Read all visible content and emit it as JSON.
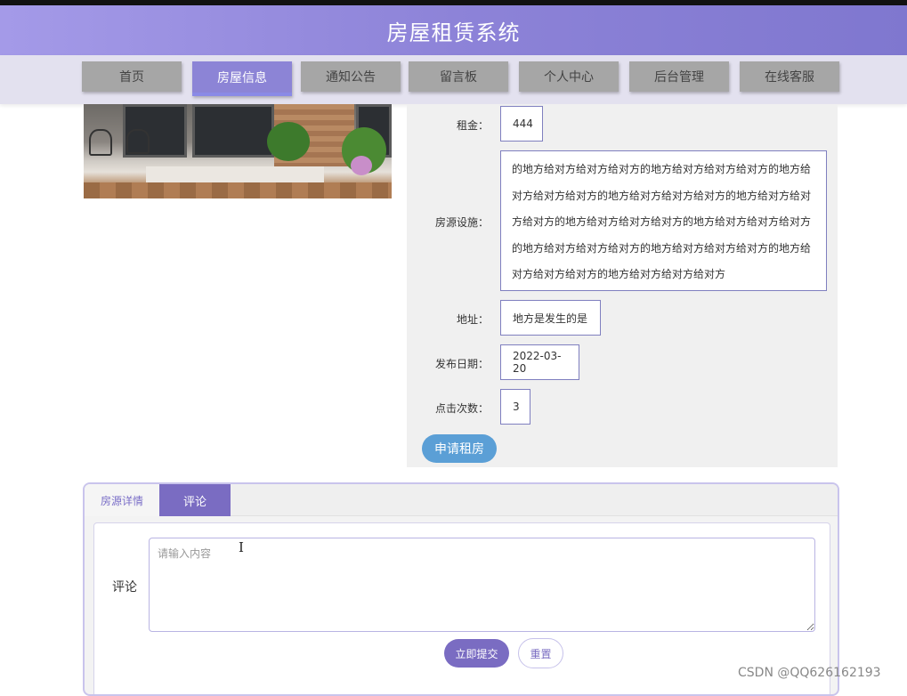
{
  "header": {
    "title": "房屋租赁系统"
  },
  "nav": {
    "items": [
      {
        "label": "首页",
        "active": false
      },
      {
        "label": "房屋信息",
        "active": true
      },
      {
        "label": "通知公告",
        "active": false
      },
      {
        "label": "留言板",
        "active": false
      },
      {
        "label": "个人中心",
        "active": false
      },
      {
        "label": "后台管理",
        "active": false
      },
      {
        "label": "在线客服",
        "active": false
      }
    ]
  },
  "detail": {
    "rent": {
      "label": "租金：",
      "value": "444"
    },
    "facilities": {
      "label": "房源设施：",
      "lines": [
        "的地方给对方给对方给对方的地方给对方给对方给对方的地方给",
        "对方给对方给对方的地方给对方给对方给对方的地方给对方给对",
        "方给对方的地方给对方给对方给对方的地方给对方给对方给对方",
        "的地方给对方给对方给对方的地方给对方给对方给对方的地方给",
        "对方给对方给对方的地方给对方给对方给对方"
      ]
    },
    "address": {
      "label": "地址：",
      "value": "地方是发生的是"
    },
    "publish_date": {
      "label": "发布日期：",
      "value": "2022-03-20"
    },
    "clicks": {
      "label": "点击次数：",
      "value": "3"
    },
    "apply_button": "申请租房"
  },
  "tabs": {
    "items": [
      {
        "label": "房源详情",
        "active": false
      },
      {
        "label": "评论",
        "active": true
      }
    ]
  },
  "comment": {
    "label": "评论",
    "placeholder": "请输入内容",
    "submit_label": "立即提交",
    "reset_label": "重置"
  },
  "watermark": "CSDN @QQ626162193",
  "colors": {
    "header": "#8d83d8",
    "accent": "#7a6cc2",
    "apply": "#5b9fd6"
  }
}
